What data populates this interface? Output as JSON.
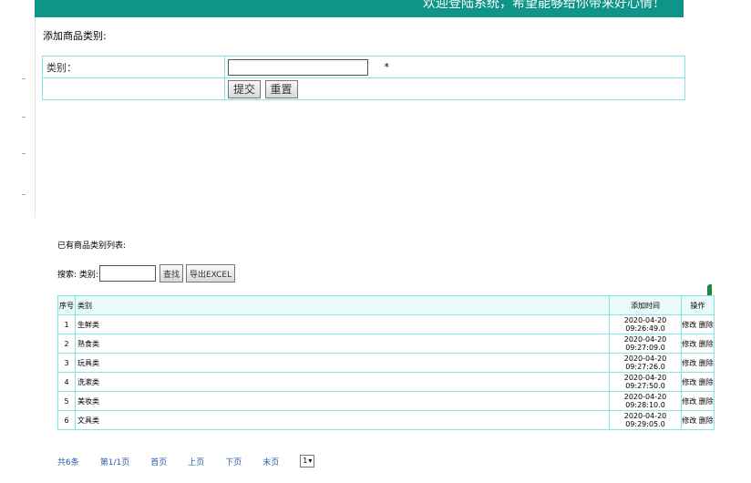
{
  "header": {
    "welcome_text": "欢迎登陆系统，希望能够给你带来好心情！"
  },
  "add_form": {
    "title": "添加商品类别:",
    "category_label": "类别：",
    "category_value": "",
    "required_mark": "*",
    "submit_label": "提交",
    "reset_label": "重置"
  },
  "list": {
    "title": "已有商品类别列表:",
    "search_prefix": "搜索: 类别:",
    "search_value": "",
    "find_label": "查找",
    "export_label": "导出EXCEL",
    "columns": {
      "no": "序号",
      "category": "类别",
      "time": "添加时间",
      "action": "操作"
    },
    "rows": [
      {
        "no": "1",
        "category": "生鲜类",
        "time": "2020-04-20 09:26:49.0",
        "edit": "修改",
        "delete": "删除"
      },
      {
        "no": "2",
        "category": "熟食类",
        "time": "2020-04-20 09:27:09.0",
        "edit": "修改",
        "delete": "删除"
      },
      {
        "no": "3",
        "category": "玩具类",
        "time": "2020-04-20 09:27:26.0",
        "edit": "修改",
        "delete": "删除"
      },
      {
        "no": "4",
        "category": "洗漱类",
        "time": "2020-04-20 09:27:50.0",
        "edit": "修改",
        "delete": "删除"
      },
      {
        "no": "5",
        "category": "美妆类",
        "time": "2020-04-20 09:28:10.0",
        "edit": "修改",
        "delete": "删除"
      },
      {
        "no": "6",
        "category": "文具类",
        "time": "2020-04-20 09:29:05.0",
        "edit": "修改",
        "delete": "删除"
      }
    ]
  },
  "pager": {
    "total": "共6条",
    "page_info": "第1/1页",
    "first": "首页",
    "prev": "上页",
    "next": "下页",
    "last": "末页",
    "page_select": "1"
  },
  "colors": {
    "header_bg": "#0e9488",
    "table_border": "#7ee7e7",
    "link": "#2f5ea8"
  }
}
